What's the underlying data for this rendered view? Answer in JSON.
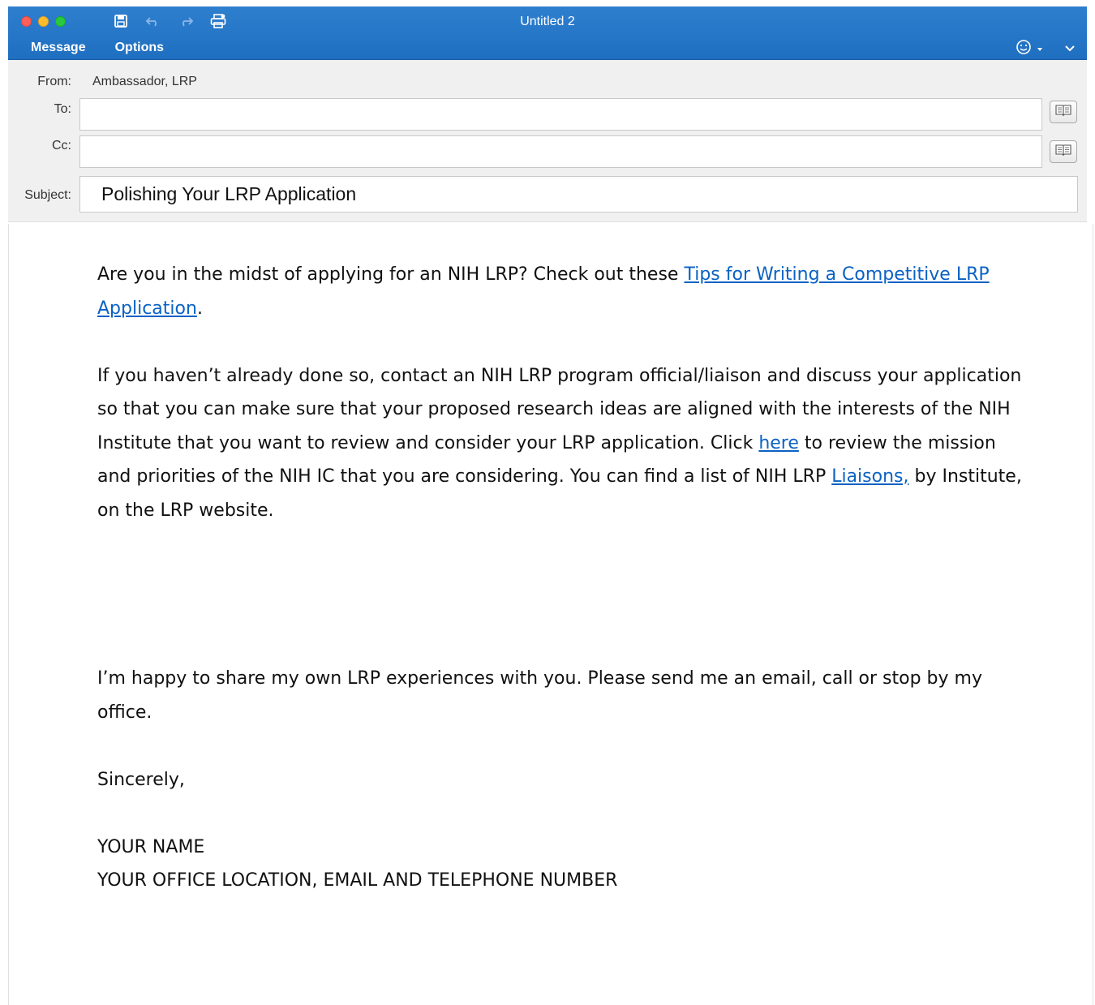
{
  "window": {
    "title": "Untitled 2",
    "colors": {
      "ribbon": "#1f6fc1",
      "link": "#0b62c4"
    }
  },
  "toolbar": {
    "icons": [
      "save-icon",
      "undo-icon",
      "redo-icon",
      "print-icon"
    ]
  },
  "ribbon": {
    "tabs": [
      {
        "label": "Message"
      },
      {
        "label": "Options"
      }
    ],
    "right_icons": [
      "smiley-icon",
      "chevron-down-icon"
    ]
  },
  "header": {
    "from_label": "From:",
    "from_value": "Ambassador, LRP",
    "to_label": "To:",
    "to_value": "",
    "cc_label": "Cc:",
    "cc_value": "",
    "subject_label": "Subject:",
    "subject_value": "Polishing Your LRP Application"
  },
  "body": {
    "p1_text": "Are you in the midst of applying for an NIH LRP? Check out these ",
    "p1_link": "Tips for Writing a Competitive LRP Application",
    "p1_end": ".",
    "p2_text": "If you haven’t already done so, contact an NIH LRP program official/liaison and discuss your application so that you can make sure that your proposed research ideas are aligned with the interests of the NIH Institute that you want to review and consider your LRP application. Click ",
    "p2_link1": "here",
    "p2_mid": " to review the mission and priorities of the NIH IC that you are considering. You can find a list of NIH LRP ",
    "p2_link2": "Liaisons,",
    "p2_end": " by Institute, on the LRP website.",
    "p3": "I’m happy to share my own LRP experiences with you. Please send me an email, call or stop by my office.",
    "closing": "Sincerely,",
    "sig_name": "YOUR NAME",
    "sig_details": "YOUR OFFICE LOCATION, EMAIL AND TELEPHONE NUMBER"
  }
}
